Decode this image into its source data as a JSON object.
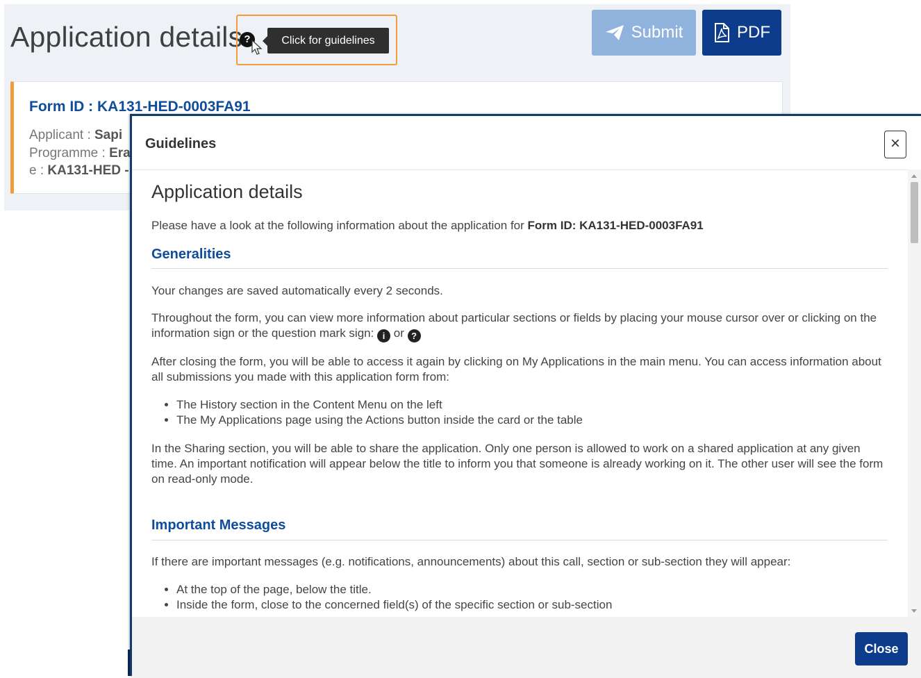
{
  "header": {
    "title": "Application details",
    "help_icon_glyph": "?",
    "tooltip": "Click for guidelines",
    "submit_label": "Submit",
    "pdf_label": "PDF"
  },
  "card": {
    "form_id": "Form ID : KA131-HED-0003FA91",
    "applicant_label": "Applicant : ",
    "applicant_value": "Sapi",
    "programme_label": "Programme : ",
    "programme_value": "Era",
    "code_label": "e : ",
    "code_value": "KA131-HED -"
  },
  "modal": {
    "title": "Guidelines",
    "close_x": "×",
    "section_title": "Application details",
    "intro": "Please have a look at the following information about the application for ",
    "intro_bold": "Form ID: KA131-HED-0003FA91",
    "generalities_heading": "Generalities",
    "p_saved": "Your changes are saved automatically every 2 seconds.",
    "p_info_before": "Throughout the form, you can view more information about particular sections or fields by placing your mouse cursor over or clicking on the information sign or the question mark sign: ",
    "p_info_or": " or ",
    "info_glyph": "i",
    "question_glyph": "?",
    "p_access": "After closing the form, you will be able to access it again by clicking on My Applications in the main menu. You can access information about all submissions you made with this application form from:",
    "access_items": [
      "The History section in the Content Menu on the left",
      "The My Applications page using the Actions button inside the card or the table"
    ],
    "p_sharing": "In the Sharing section, you will be able to share the application. Only one person is allowed to work on a shared application at any given time. An important notification will appear below the title to inform you that someone is already working on it. The other user will see the form on read-only mode.",
    "messages_heading": "Important Messages",
    "p_messages": "If there are important messages (e.g. notifications, announcements) about this call, section or sub-section they will appear:",
    "messages_items": [
      "At the top of the page, below the title.",
      "Inside the form, close to the concerned field(s) of the specific section or sub-section"
    ],
    "close_button": "Close"
  },
  "colors": {
    "accent_blue": "#0e3c8c",
    "link_blue": "#0e4c9c",
    "highlight_orange": "#f29b3a",
    "submit_disabled": "#8fb3dc"
  }
}
